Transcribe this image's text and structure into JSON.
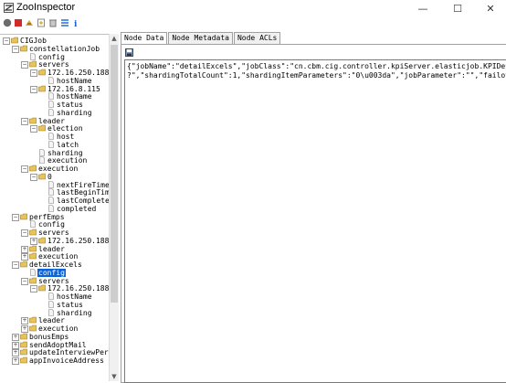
{
  "window": {
    "title": "ZooInspector",
    "minimize": "—",
    "maximize": "☐",
    "close": "✕"
  },
  "toolbar": {
    "buttons": [
      "connect-icon",
      "disconnect-icon",
      "refresh-icon",
      "add-node-icon",
      "delete-node-icon",
      "settings-icon",
      "info-icon"
    ]
  },
  "tree": {
    "rows": [
      {
        "label": "CIGJob",
        "depth": 0,
        "toggle": "−",
        "icon": "folder"
      },
      {
        "label": "constellationJob",
        "depth": 1,
        "toggle": "−",
        "icon": "folder"
      },
      {
        "label": "config",
        "depth": 2,
        "toggle": "",
        "icon": "file"
      },
      {
        "label": "servers",
        "depth": 2,
        "toggle": "−",
        "icon": "folder"
      },
      {
        "label": "172.16.250.188",
        "depth": 3,
        "toggle": "−",
        "icon": "folder"
      },
      {
        "label": "hostName",
        "depth": 4,
        "toggle": "",
        "icon": "file"
      },
      {
        "label": "172.16.8.115",
        "depth": 3,
        "toggle": "−",
        "icon": "folder"
      },
      {
        "label": "hostName",
        "depth": 4,
        "toggle": "",
        "icon": "file"
      },
      {
        "label": "status",
        "depth": 4,
        "toggle": "",
        "icon": "file"
      },
      {
        "label": "sharding",
        "depth": 4,
        "toggle": "",
        "icon": "file"
      },
      {
        "label": "leader",
        "depth": 2,
        "toggle": "−",
        "icon": "folder"
      },
      {
        "label": "election",
        "depth": 3,
        "toggle": "−",
        "icon": "folder"
      },
      {
        "label": "host",
        "depth": 4,
        "toggle": "",
        "icon": "file"
      },
      {
        "label": "latch",
        "depth": 4,
        "toggle": "",
        "icon": "file"
      },
      {
        "label": "sharding",
        "depth": 3,
        "toggle": "",
        "icon": "file"
      },
      {
        "label": "execution",
        "depth": 3,
        "toggle": "",
        "icon": "file"
      },
      {
        "label": "execution",
        "depth": 2,
        "toggle": "−",
        "icon": "folder"
      },
      {
        "label": "0",
        "depth": 3,
        "toggle": "−",
        "icon": "folder"
      },
      {
        "label": "nextFireTime",
        "depth": 4,
        "toggle": "",
        "icon": "file"
      },
      {
        "label": "lastBeginTim",
        "depth": 4,
        "toggle": "",
        "icon": "file"
      },
      {
        "label": "lastComplete",
        "depth": 4,
        "toggle": "",
        "icon": "file"
      },
      {
        "label": "completed",
        "depth": 4,
        "toggle": "",
        "icon": "file"
      },
      {
        "label": "perfEmps",
        "depth": 1,
        "toggle": "−",
        "icon": "folder"
      },
      {
        "label": "config",
        "depth": 2,
        "toggle": "",
        "icon": "file"
      },
      {
        "label": "servers",
        "depth": 2,
        "toggle": "−",
        "icon": "folder"
      },
      {
        "label": "172.16.250.188",
        "depth": 3,
        "toggle": "+",
        "icon": "folder"
      },
      {
        "label": "leader",
        "depth": 2,
        "toggle": "+",
        "icon": "folder"
      },
      {
        "label": "execution",
        "depth": 2,
        "toggle": "+",
        "icon": "folder"
      },
      {
        "label": "detailExcels",
        "depth": 1,
        "toggle": "−",
        "icon": "folder"
      },
      {
        "label": "config",
        "depth": 2,
        "toggle": "",
        "icon": "file",
        "selected": true
      },
      {
        "label": "servers",
        "depth": 2,
        "toggle": "−",
        "icon": "folder"
      },
      {
        "label": "172.16.250.188",
        "depth": 3,
        "toggle": "−",
        "icon": "folder"
      },
      {
        "label": "hostName",
        "depth": 4,
        "toggle": "",
        "icon": "file"
      },
      {
        "label": "status",
        "depth": 4,
        "toggle": "",
        "icon": "file"
      },
      {
        "label": "sharding",
        "depth": 4,
        "toggle": "",
        "icon": "file"
      },
      {
        "label": "leader",
        "depth": 2,
        "toggle": "+",
        "icon": "folder"
      },
      {
        "label": "execution",
        "depth": 2,
        "toggle": "+",
        "icon": "folder"
      },
      {
        "label": "bonusEmps",
        "depth": 1,
        "toggle": "+",
        "icon": "folder"
      },
      {
        "label": "sendAdoptMail",
        "depth": 1,
        "toggle": "+",
        "icon": "folder"
      },
      {
        "label": "updateInterviewPers",
        "depth": 1,
        "toggle": "+",
        "icon": "folder"
      },
      {
        "label": "appInvoiceAddress",
        "depth": 1,
        "toggle": "+",
        "icon": "folder"
      }
    ]
  },
  "tabs": [
    {
      "label": "Node Data",
      "active": true
    },
    {
      "label": "Node Metadata",
      "active": false
    },
    {
      "label": "Node ACLs",
      "active": false
    }
  ],
  "node_data": {
    "lines": [
      "{\"jobName\":\"detailExcels\",\"jobClass\":\"cn.cbm.cig.controller.kpiServer.elasticjob.KPIDetailExcel",
      "?\",\"shardingTotalCount\":1,\"shardingItemParameters\":\"0\\u003da\",\"jobParameter\":\"\",\"failover\":fals"
    ]
  },
  "colors": {
    "selection": "#0a64d8",
    "folder": "#e8c35a",
    "file": "#f4f4f4"
  }
}
